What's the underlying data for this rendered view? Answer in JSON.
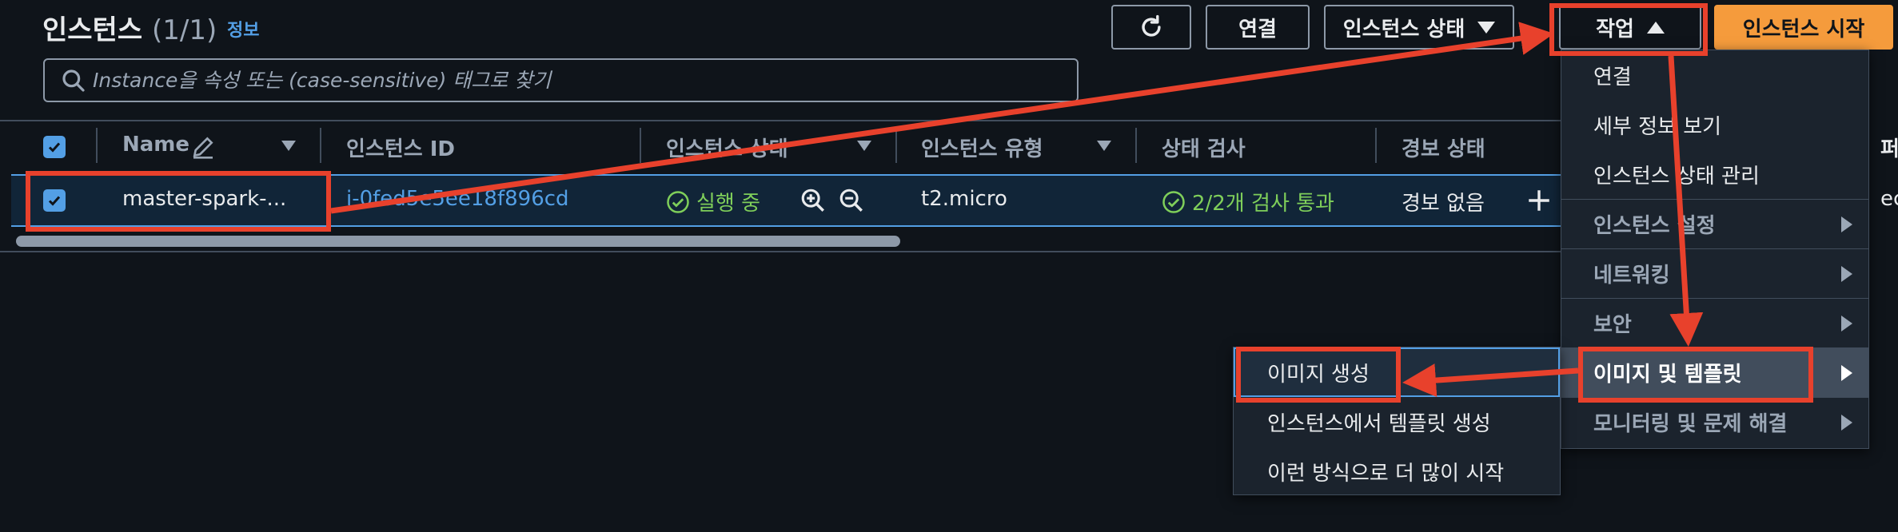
{
  "header": {
    "title": "인스턴스",
    "count": "(1/1)",
    "info_link": "정보"
  },
  "toolbar": {
    "refresh_icon": "refresh-icon",
    "connect_label": "연결",
    "instance_state_label": "인스턴스 상태",
    "actions_label": "작업",
    "launch_label": "인스턴스 시작"
  },
  "search": {
    "placeholder": "Instance을 속성 또는 (case-sensitive) 태그로 찾기",
    "value": ""
  },
  "table": {
    "columns": [
      "Name",
      "인스턴스 ID",
      "인스턴스 상태",
      "인스턴스 유형",
      "상태 검사",
      "경보 상태",
      "퍼"
    ],
    "rows": [
      {
        "selected": true,
        "name": "master-spark-...",
        "instance_id": "i-0fed5e5ee18f896cd",
        "state": "실행 중",
        "type": "t2.micro",
        "status_check": "2/2개 검사 통과",
        "alarm": "경보 없음",
        "next_col": "ec"
      }
    ]
  },
  "actions_menu": {
    "items": [
      {
        "label": "연결",
        "kind": "item"
      },
      {
        "label": "세부 정보 보기",
        "kind": "item"
      },
      {
        "label": "인스턴스 상태 관리",
        "kind": "item"
      },
      {
        "label": "인스턴스 설정",
        "kind": "submenu"
      },
      {
        "label": "네트워킹",
        "kind": "submenu"
      },
      {
        "label": "보안",
        "kind": "submenu"
      },
      {
        "label": "이미지 및 템플릿",
        "kind": "submenu-active"
      },
      {
        "label": "모니터링 및 문제 해결",
        "kind": "submenu"
      }
    ]
  },
  "image_submenu": {
    "items": [
      {
        "label": "이미지 생성"
      },
      {
        "label": "인스턴스에서 템플릿 생성"
      },
      {
        "label": "이런 방식으로 더 많이 시작"
      }
    ]
  },
  "colors": {
    "background": "#0f141a",
    "accent_blue": "#539fe5",
    "primary_orange": "#f59b3c",
    "success_green": "#7fcf5a",
    "annotation_red": "#e8412c"
  }
}
